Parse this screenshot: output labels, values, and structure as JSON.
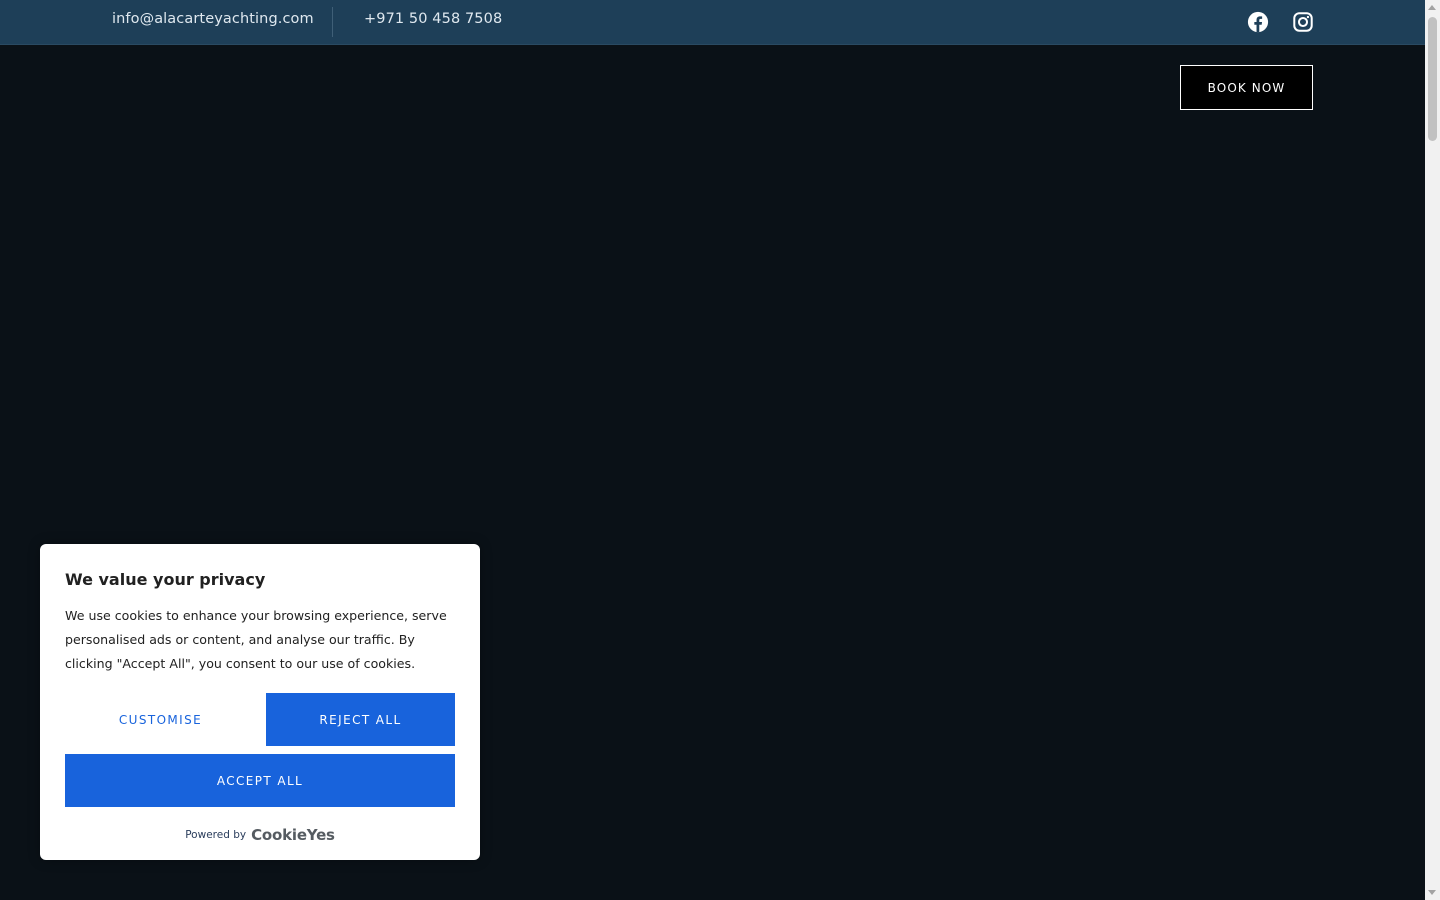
{
  "topbar": {
    "email": "info@alacarteyachting.com",
    "phone": "+971 50 458 7508",
    "social": [
      {
        "icon": "facebook-icon"
      },
      {
        "icon": "instagram-icon"
      }
    ]
  },
  "header": {
    "book_now_label": "BOOK NOW"
  },
  "cookie_banner": {
    "title": "We value your privacy",
    "text": "We use cookies to enhance your browsing experience, serve personalised ads or content, and analyse our traffic. By clicking \"Accept All\", you consent to our use of cookies.",
    "customise_label": "CUSTOMISE",
    "reject_label": "REJECT ALL",
    "accept_label": "ACCEPT ALL",
    "powered_by_label": "Powered by",
    "brand_name": "CookieYes"
  },
  "colors": {
    "topbar_bg": "#1e3f58",
    "page_bg": "#0a1117",
    "cookie_accent": "#1863dc"
  }
}
